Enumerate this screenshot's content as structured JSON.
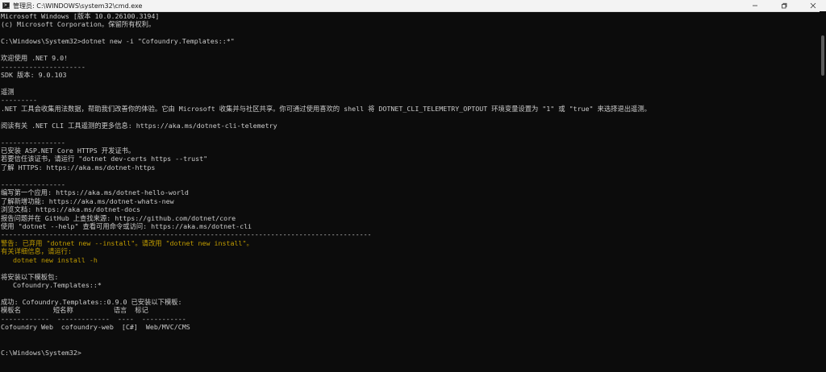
{
  "window": {
    "title": "管理员: C:\\WINDOWS\\system32\\cmd.exe",
    "icon": "cmd-icon",
    "controls": [
      "minimize-icon",
      "maximize-icon",
      "close-icon"
    ]
  },
  "colors": {
    "background": "#0c0c0c",
    "text": "#cccccc",
    "warning": "#c19c00"
  },
  "console": {
    "lines": [
      {
        "text": "Microsoft Windows [版本 10.0.26100.3194]",
        "style": "normal"
      },
      {
        "text": "(c) Microsoft Corporation。保留所有权利。",
        "style": "normal"
      },
      {
        "text": "",
        "style": "normal"
      },
      {
        "text": "C:\\Windows\\System32>dotnet new -i \"Cofoundry.Templates::*\"",
        "style": "normal"
      },
      {
        "text": "",
        "style": "normal"
      },
      {
        "text": "欢迎使用 .NET 9.0!",
        "style": "normal"
      },
      {
        "text": "---------------------",
        "style": "normal"
      },
      {
        "text": "SDK 版本: 9.0.103",
        "style": "normal"
      },
      {
        "text": "",
        "style": "normal"
      },
      {
        "text": "遥测",
        "style": "normal"
      },
      {
        "text": "---------",
        "style": "normal"
      },
      {
        "text": ".NET 工具会收集用法数据，帮助我们改善你的体验。它由 Microsoft 收集并与社区共享。你可通过使用喜欢的 shell 将 DOTNET_CLI_TELEMETRY_OPTOUT 环境变量设置为 \"1\" 或 \"true\" 来选择退出遥测。",
        "style": "normal"
      },
      {
        "text": "",
        "style": "normal"
      },
      {
        "text": "阅读有关 .NET CLI 工具遥测的更多信息: https://aka.ms/dotnet-cli-telemetry",
        "style": "normal"
      },
      {
        "text": "",
        "style": "normal"
      },
      {
        "text": "----------------",
        "style": "normal"
      },
      {
        "text": "已安装 ASP.NET Core HTTPS 开发证书。",
        "style": "normal"
      },
      {
        "text": "若要信任该证书，请运行 \"dotnet dev-certs https --trust\"",
        "style": "normal"
      },
      {
        "text": "了解 HTTPS: https://aka.ms/dotnet-https",
        "style": "normal"
      },
      {
        "text": "",
        "style": "normal"
      },
      {
        "text": "----------------",
        "style": "normal"
      },
      {
        "text": "编写第一个应用: https://aka.ms/dotnet-hello-world",
        "style": "normal"
      },
      {
        "text": "了解新增功能: https://aka.ms/dotnet-whats-new",
        "style": "normal"
      },
      {
        "text": "浏览文档: https://aka.ms/dotnet-docs",
        "style": "normal"
      },
      {
        "text": "报告问题并在 GitHub 上查找来源: https://github.com/dotnet/core",
        "style": "normal"
      },
      {
        "text": "使用 \"dotnet --help\" 查看可用命令或访问: https://aka.ms/dotnet-cli",
        "style": "normal"
      },
      {
        "text": "--------------------------------------------------------------------------------------------",
        "style": "normal"
      },
      {
        "text": "警告: 已弃用 \"dotnet new --install\"。请改用 \"dotnet new install\"。",
        "style": "warn"
      },
      {
        "text": "有关详细信息，请运行:",
        "style": "warn"
      },
      {
        "text": "   dotnet new install -h",
        "style": "warn"
      },
      {
        "text": "",
        "style": "normal"
      },
      {
        "text": "将安装以下模板包:",
        "style": "normal"
      },
      {
        "text": "   Cofoundry.Templates::*",
        "style": "normal"
      },
      {
        "text": "",
        "style": "normal"
      },
      {
        "text": "成功: Cofoundry.Templates::0.9.0 已安装以下模板:",
        "style": "normal"
      },
      {
        "text": "模板名        短名称          语言  标记",
        "style": "normal"
      },
      {
        "text": "------------  -------------  ----  -----------",
        "style": "normal"
      },
      {
        "text": "Cofoundry Web  cofoundry-web  [C#]  Web/MVC/CMS",
        "style": "normal"
      },
      {
        "text": "",
        "style": "normal"
      },
      {
        "text": "",
        "style": "normal"
      },
      {
        "text": "C:\\Windows\\System32>",
        "style": "normal"
      }
    ]
  }
}
